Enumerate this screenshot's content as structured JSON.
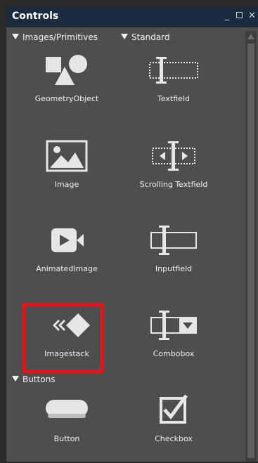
{
  "window": {
    "title": "Controls",
    "minimize": "_",
    "close": "✕"
  },
  "sections": [
    {
      "label": "Images/Primitives"
    },
    {
      "label": "Standard"
    },
    {
      "label": "Buttons"
    }
  ],
  "items": [
    {
      "label": "GeometryObject",
      "icon": "geometry-object-icon"
    },
    {
      "label": "Textfield",
      "icon": "textfield-icon"
    },
    {
      "label": "Image",
      "icon": "image-icon"
    },
    {
      "label": "Scrolling Textfield",
      "icon": "scrolling-textfield-icon"
    },
    {
      "label": "AnimatedImage",
      "icon": "animated-image-icon"
    },
    {
      "label": "Inputfield",
      "icon": "inputfield-icon"
    },
    {
      "label": "Imagestack",
      "icon": "imagestack-icon",
      "selected": true
    },
    {
      "label": "Combobox",
      "icon": "combobox-icon"
    },
    {
      "label": "Button",
      "icon": "button-icon"
    },
    {
      "label": "Checkbox",
      "icon": "checkbox-icon"
    }
  ],
  "colors": {
    "panel": "#4e4e4e",
    "titlebar": "#1b2b40",
    "icon": "#e6e6e6",
    "highlight": "#e4141b"
  }
}
